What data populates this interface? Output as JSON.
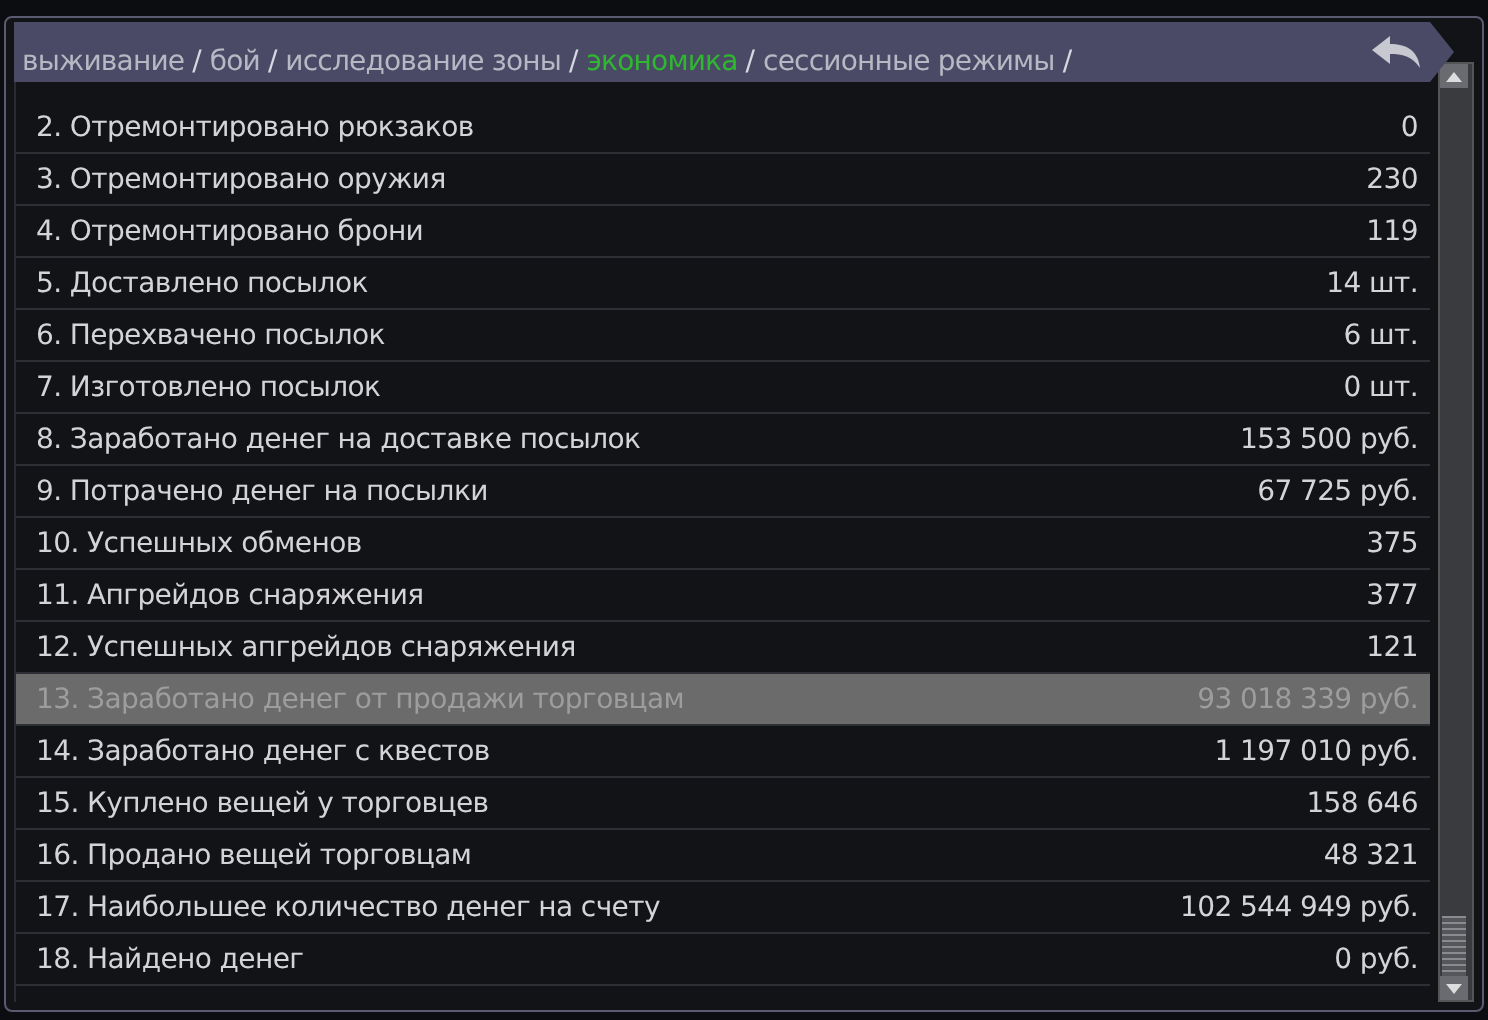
{
  "breadcrumb": [
    {
      "label": "выживание",
      "selected": false,
      "separator": "/"
    },
    {
      "label": "бой",
      "selected": false,
      "separator": "/"
    },
    {
      "label": "исследование зоны",
      "selected": false,
      "separator": "/"
    },
    {
      "label": "экономика",
      "selected": true,
      "separator": "/"
    },
    {
      "label": "сессионные режимы",
      "selected": false,
      "separator": "/"
    }
  ],
  "rows": [
    {
      "label": "2. Отремонтировано рюкзаков",
      "value": "0",
      "selected": false
    },
    {
      "label": "3. Отремонтировано оружия",
      "value": "230",
      "selected": false
    },
    {
      "label": "4. Отремонтировано брони",
      "value": "119",
      "selected": false
    },
    {
      "label": "5. Доставлено посылок",
      "value": "14 шт.",
      "selected": false
    },
    {
      "label": "6. Перехвачено посылок",
      "value": "6 шт.",
      "selected": false
    },
    {
      "label": "7. Изготовлено посылок",
      "value": "0 шт.",
      "selected": false
    },
    {
      "label": "8. Заработано денег на доставке посылок",
      "value": "153 500 руб.",
      "selected": false
    },
    {
      "label": "9. Потрачено денег на посылки",
      "value": "67 725 руб.",
      "selected": false
    },
    {
      "label": "10. Успешных обменов",
      "value": "375",
      "selected": false
    },
    {
      "label": "11. Апгрейдов снаряжения",
      "value": "377",
      "selected": false
    },
    {
      "label": "12. Успешных апгрейдов снаряжения",
      "value": "121",
      "selected": false
    },
    {
      "label": "13. Заработано денег от продажи торговцам",
      "value": "93 018 339 руб.",
      "selected": true
    },
    {
      "label": "14. Заработано денег с квестов",
      "value": "1 197 010 руб.",
      "selected": false
    },
    {
      "label": "15. Куплено вещей у торговцев",
      "value": "158 646",
      "selected": false
    },
    {
      "label": "16. Продано вещей торговцам",
      "value": "48 321",
      "selected": false
    },
    {
      "label": "17. Наибольшее количество денег на счету",
      "value": "102 544 949 руб.",
      "selected": false
    },
    {
      "label": "18. Найдено денег",
      "value": "0 руб.",
      "selected": false
    }
  ]
}
